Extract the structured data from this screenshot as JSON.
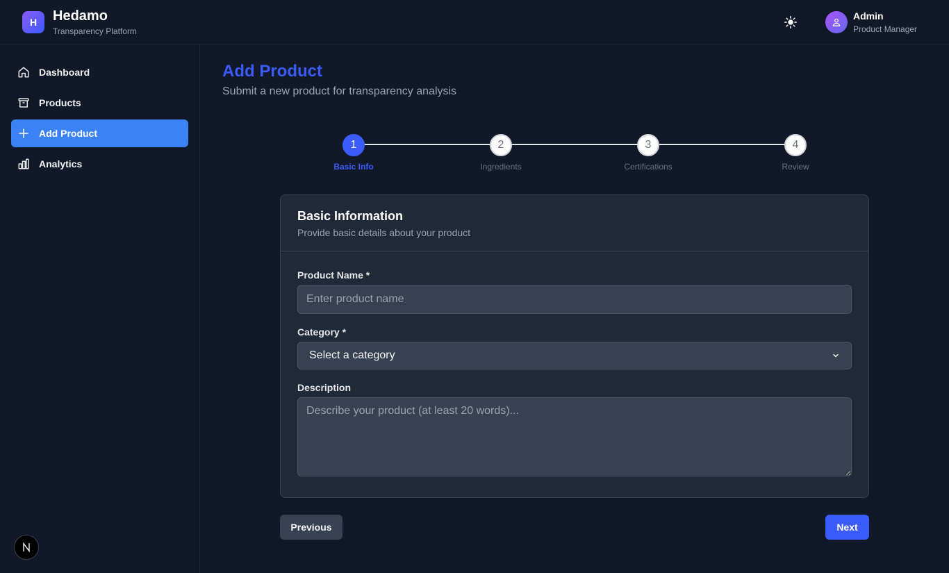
{
  "header": {
    "logo_letter": "H",
    "brand_name": "Hedamo",
    "brand_subtitle": "Transparency Platform",
    "theme_icon": "sun-icon",
    "user_name": "Admin",
    "user_role": "Product Manager"
  },
  "sidebar": {
    "items": [
      {
        "label": "Dashboard",
        "icon": "home-icon",
        "active": false
      },
      {
        "label": "Products",
        "icon": "archive-icon",
        "active": false
      },
      {
        "label": "Add Product",
        "icon": "plus-icon",
        "active": true
      },
      {
        "label": "Analytics",
        "icon": "bar-chart-icon",
        "active": false
      }
    ],
    "badge_letter": "N"
  },
  "main": {
    "title": "Add Product",
    "subtitle": "Submit a new product for transparency analysis"
  },
  "stepper": {
    "current": 1,
    "steps": [
      {
        "number": "1",
        "label": "Basic Info"
      },
      {
        "number": "2",
        "label": "Ingredients"
      },
      {
        "number": "3",
        "label": "Certifications"
      },
      {
        "number": "4",
        "label": "Review"
      }
    ]
  },
  "form": {
    "card_title": "Basic Information",
    "card_description": "Provide basic details about your product",
    "product_name_label": "Product Name *",
    "product_name_placeholder": "Enter product name",
    "product_name_value": "",
    "category_label": "Category *",
    "category_selected": "Select a category",
    "description_label": "Description",
    "description_placeholder": "Describe your product (at least 20 words)...",
    "description_value": ""
  },
  "actions": {
    "previous_label": "Previous",
    "next_label": "Next"
  },
  "colors": {
    "accent": "#3b5bfd",
    "nav_active": "#3b82f6",
    "background": "#111827",
    "card": "#1f2937"
  }
}
